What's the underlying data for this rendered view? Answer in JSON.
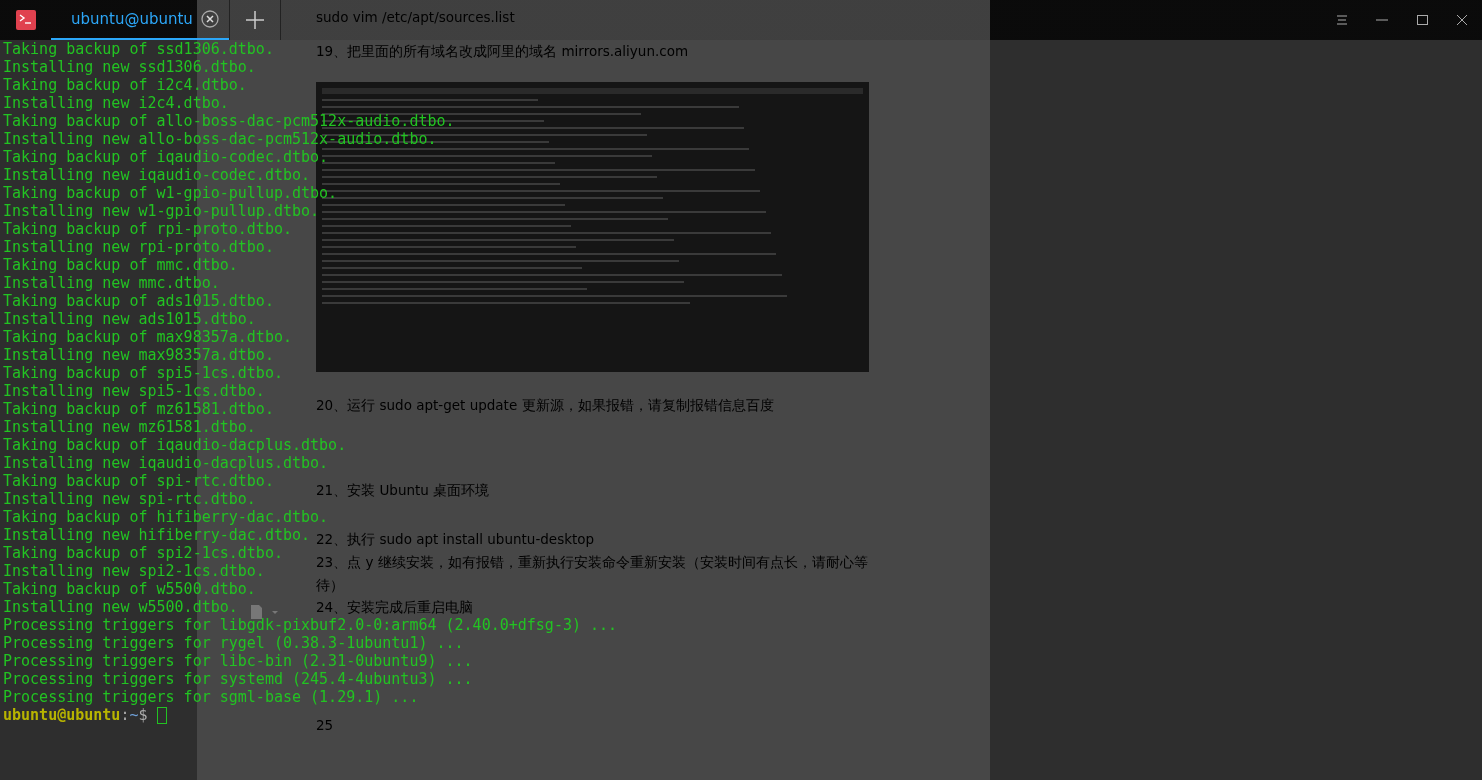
{
  "document": {
    "lines": [
      {
        "kind": "text",
        "text": "sudo vim /etc/apt/sources.list"
      },
      {
        "kind": "text",
        "text": "19、把里面的所有域名改成阿里的域名  mirrors.aliyun.com"
      },
      {
        "kind": "image"
      },
      {
        "kind": "text",
        "text": "20、运行  sudo apt-get update  更新源，如果报错，请复制报错信息百度"
      },
      {
        "kind": "text",
        "text": "21、安装 Ubuntu 桌面环境"
      },
      {
        "kind": "text",
        "text": "22、执行  sudo apt install ubuntu-desktop"
      },
      {
        "kind": "text",
        "text": "23、点 y  继续安装，如有报错，重新执行安装命令重新安装（安装时间有点长，请耐心等"
      },
      {
        "kind": "text",
        "text": "待）"
      },
      {
        "kind": "text",
        "text": "24、安装完成后重启电脑"
      },
      {
        "kind": "text",
        "text": "25"
      }
    ]
  },
  "window": {
    "tabs": [
      {
        "title": "ubuntu@ubuntu",
        "selected": true
      }
    ]
  },
  "terminal": {
    "lines": [
      "Taking backup of ssd1306.dtbo.",
      "Installing new ssd1306.dtbo.",
      "Taking backup of i2c4.dtbo.",
      "Installing new i2c4.dtbo.",
      "Taking backup of allo-boss-dac-pcm512x-audio.dtbo.",
      "Installing new allo-boss-dac-pcm512x-audio.dtbo.",
      "Taking backup of iqaudio-codec.dtbo.",
      "Installing new iqaudio-codec.dtbo.",
      "Taking backup of w1-gpio-pullup.dtbo.",
      "Installing new w1-gpio-pullup.dtbo.",
      "Taking backup of rpi-proto.dtbo.",
      "Installing new rpi-proto.dtbo.",
      "Taking backup of mmc.dtbo.",
      "Installing new mmc.dtbo.",
      "Taking backup of ads1015.dtbo.",
      "Installing new ads1015.dtbo.",
      "Taking backup of max98357a.dtbo.",
      "Installing new max98357a.dtbo.",
      "Taking backup of spi5-1cs.dtbo.",
      "Installing new spi5-1cs.dtbo.",
      "Taking backup of mz61581.dtbo.",
      "Installing new mz61581.dtbo.",
      "Taking backup of iqaudio-dacplus.dtbo.",
      "Installing new iqaudio-dacplus.dtbo.",
      "Taking backup of spi-rtc.dtbo.",
      "Installing new spi-rtc.dtbo.",
      "Taking backup of hifiberry-dac.dtbo.",
      "Installing new hifiberry-dac.dtbo.",
      "Taking backup of spi2-1cs.dtbo.",
      "Installing new spi2-1cs.dtbo.",
      "Taking backup of w5500.dtbo.",
      "Installing new w5500.dtbo.",
      "Processing triggers for libgdk-pixbuf2.0-0:arm64 (2.40.0+dfsg-3) ...",
      "Processing triggers for rygel (0.38.3-1ubuntu1) ...",
      "Processing triggers for libc-bin (2.31-0ubuntu9) ...",
      "Processing triggers for systemd (245.4-4ubuntu3) ...",
      "Processing triggers for sgml-base (1.29.1) ..."
    ],
    "prompt": {
      "user_host": "ubuntu@ubuntu",
      "separator": ":",
      "path": "~",
      "symbol": "$"
    }
  }
}
